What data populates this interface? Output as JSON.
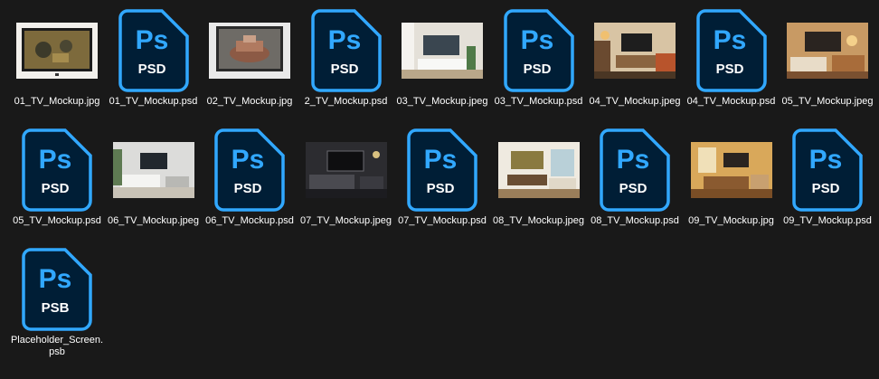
{
  "colors": {
    "background": "#191919",
    "ps_fill": "#001e36",
    "ps_accent": "#31a8ff",
    "text": "#ffffff"
  },
  "files": [
    {
      "name": "01_TV_Mockup.jpg",
      "kind": "image",
      "scene": "01",
      "icon": "image-thumbnail"
    },
    {
      "name": "01_TV_Mockup.psd",
      "kind": "ps",
      "badge": "PSD",
      "icon": "photoshop-psd-icon"
    },
    {
      "name": "02_TV_Mockup.jpg",
      "kind": "image",
      "scene": "02",
      "icon": "image-thumbnail"
    },
    {
      "name": "2_TV_Mockup.psd",
      "kind": "ps",
      "badge": "PSD",
      "icon": "photoshop-psd-icon"
    },
    {
      "name": "03_TV_Mockup.jpeg",
      "kind": "image",
      "scene": "03",
      "icon": "image-thumbnail"
    },
    {
      "name": "03_TV_Mockup.psd",
      "kind": "ps",
      "badge": "PSD",
      "icon": "photoshop-psd-icon"
    },
    {
      "name": "04_TV_Mockup.jpeg",
      "kind": "image",
      "scene": "04",
      "icon": "image-thumbnail"
    },
    {
      "name": "04_TV_Mockup.psd",
      "kind": "ps",
      "badge": "PSD",
      "icon": "photoshop-psd-icon"
    },
    {
      "name": "05_TV_Mockup.jpeg",
      "kind": "image",
      "scene": "05",
      "icon": "image-thumbnail"
    },
    {
      "name": "05_TV_Mockup.psd",
      "kind": "ps",
      "badge": "PSD",
      "icon": "photoshop-psd-icon"
    },
    {
      "name": "06_TV_Mockup.jpeg",
      "kind": "image",
      "scene": "06",
      "icon": "image-thumbnail"
    },
    {
      "name": "06_TV_Mockup.psd",
      "kind": "ps",
      "badge": "PSD",
      "icon": "photoshop-psd-icon"
    },
    {
      "name": "07_TV_Mockup.jpeg",
      "kind": "image",
      "scene": "07",
      "icon": "image-thumbnail"
    },
    {
      "name": "07_TV_Mockup.psd",
      "kind": "ps",
      "badge": "PSD",
      "icon": "photoshop-psd-icon"
    },
    {
      "name": "08_TV_Mockup.jpeg",
      "kind": "image",
      "scene": "08",
      "icon": "image-thumbnail"
    },
    {
      "name": "08_TV_Mockup.psd",
      "kind": "ps",
      "badge": "PSD",
      "icon": "photoshop-psd-icon"
    },
    {
      "name": "09_TV_Mockup.jpg",
      "kind": "image",
      "scene": "09",
      "icon": "image-thumbnail"
    },
    {
      "name": "09_TV_Mockup.psd",
      "kind": "ps",
      "badge": "PSD",
      "icon": "photoshop-psd-icon"
    },
    {
      "name": "Placeholder_Screen.psb",
      "kind": "ps",
      "badge": "PSB",
      "icon": "photoshop-psb-icon"
    }
  ]
}
